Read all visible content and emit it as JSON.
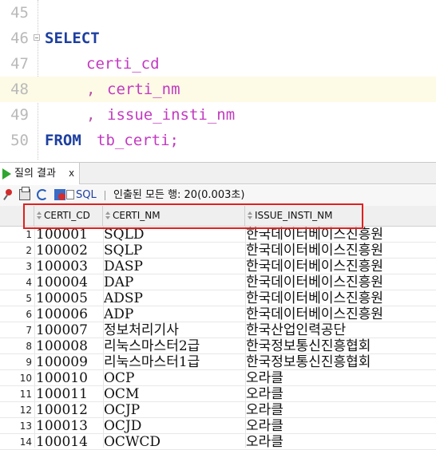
{
  "editor": {
    "lines": [
      {
        "num": "45",
        "text": ""
      },
      {
        "num": "46",
        "text": "SELECT"
      },
      {
        "num": "47",
        "text": "certi_cd"
      },
      {
        "num": "48",
        "comma": ",",
        "text": "certi_nm"
      },
      {
        "num": "49",
        "comma": ",",
        "text": "issue_insti_nm"
      },
      {
        "num": "50",
        "kw": "FROM",
        "text": "tb_certi;"
      }
    ]
  },
  "result_panel": {
    "tab_label": "질의 결과",
    "tab_close": "x",
    "toolbar": {
      "sql_label": "SQL",
      "status": "인출된 모든 행: 20(0.003초)"
    }
  },
  "grid": {
    "columns": [
      "CERTI_CD",
      "CERTI_NM",
      "ISSUE_INSTI_NM"
    ],
    "rows": [
      {
        "n": "1",
        "cd": "100001",
        "nm": "SQLD",
        "issue": "한국데이터베이스진흥원"
      },
      {
        "n": "2",
        "cd": "100002",
        "nm": "SQLP",
        "issue": "한국데이터베이스진흥원"
      },
      {
        "n": "3",
        "cd": "100003",
        "nm": "DASP",
        "issue": "한국데이터베이스진흥원"
      },
      {
        "n": "4",
        "cd": "100004",
        "nm": "DAP",
        "issue": "한국데이터베이스진흥원"
      },
      {
        "n": "5",
        "cd": "100005",
        "nm": "ADSP",
        "issue": "한국데이터베이스진흥원"
      },
      {
        "n": "6",
        "cd": "100006",
        "nm": "ADP",
        "issue": "한국데이터베이스진흥원"
      },
      {
        "n": "7",
        "cd": "100007",
        "nm": "정보처리기사",
        "issue": "한국산업인력공단"
      },
      {
        "n": "8",
        "cd": "100008",
        "nm": "리눅스마스터2급",
        "issue": "한국정보통신진흥협회"
      },
      {
        "n": "9",
        "cd": "100009",
        "nm": "리눅스마스터1급",
        "issue": "한국정보통신진흥협회"
      },
      {
        "n": "10",
        "cd": "100010",
        "nm": "OCP",
        "issue": "오라클"
      },
      {
        "n": "11",
        "cd": "100011",
        "nm": "OCM",
        "issue": "오라클"
      },
      {
        "n": "12",
        "cd": "100012",
        "nm": "OCJP",
        "issue": "오라클"
      },
      {
        "n": "13",
        "cd": "100013",
        "nm": "OCJD",
        "issue": "오라클"
      },
      {
        "n": "14",
        "cd": "100014",
        "nm": "OCWCD",
        "issue": "오라클"
      }
    ]
  }
}
